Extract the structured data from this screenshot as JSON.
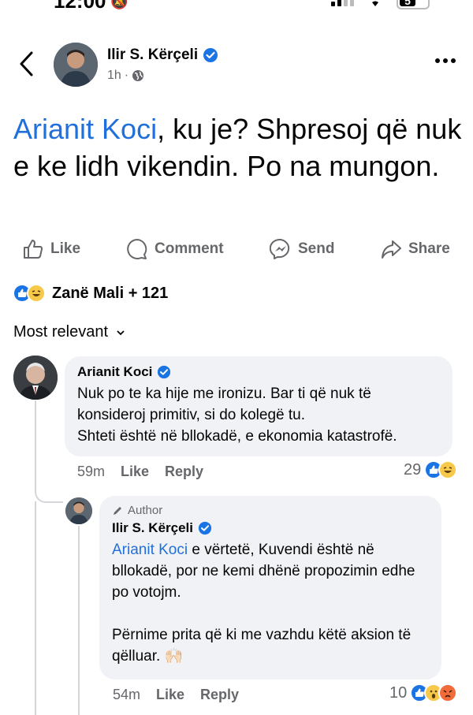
{
  "status_bar": {
    "time": "12:00",
    "battery": "5"
  },
  "header": {
    "author_name": "Ilir S. Kërçeli",
    "time_ago": "1h"
  },
  "post": {
    "mention": "Arianit Koci",
    "text": ", ku je? Shpresoj që nuk e ke lidh vikendin. Po na mungon."
  },
  "actions": {
    "like": "Like",
    "comment": "Comment",
    "send": "Send",
    "share": "Share"
  },
  "reactions": {
    "summary": "Zanë Mali + 121"
  },
  "sort": {
    "label": "Most relevant"
  },
  "comments": [
    {
      "name": "Arianit Koci",
      "text": "Nuk po te ka hije me ironizu. Bar ti që nuk të konsideroj primitiv, si do kolegë tu.\nShteti është në bllokadë, e ekonomia katastrofë.",
      "time": "59m",
      "like": "Like",
      "reply": "Reply",
      "reaction_count": "29"
    },
    {
      "author_tag": "Author",
      "name": "Ilir S. Kërçeli",
      "mention": "Arianit Koci",
      "text": " e vërtetë, Kuvendi është në bllokadë, por ne kemi dhënë propozimin edhe po votojm.\n\nPërnime prita që ki me vazhdu këtë aksion të qëlluar. 🙌🏻",
      "time": "54m",
      "like": "Like",
      "reply": "Reply",
      "reaction_count": "10"
    }
  ],
  "colors": {
    "accent": "#216fdb",
    "like_blue": "#1b74e4",
    "meta_gray": "#65676b",
    "bubble_bg": "#f0f2f5"
  }
}
